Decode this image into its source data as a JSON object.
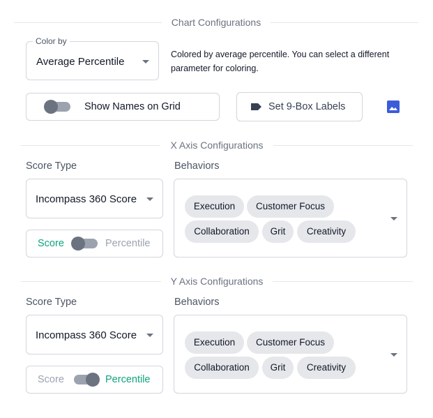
{
  "chart_config": {
    "section_title": "Chart Configurations",
    "color_by": {
      "legend": "Color by",
      "value": "Average Percentile",
      "help_text": "Colored by average percentile. You can select a different parameter for coloring."
    },
    "show_names_button": {
      "label": "Show Names on Grid",
      "enabled": false
    },
    "labels_button": {
      "label": "Set 9-Box Labels",
      "icon": "tag-icon"
    },
    "image_button": {
      "icon": "image-icon"
    }
  },
  "x_axis": {
    "section_title": "X Axis Configurations",
    "score_type_label": "Score Type",
    "score_type_value": "Incompass 360 Score",
    "toggle": {
      "left": "Score",
      "right": "Percentile",
      "selected": "Score"
    },
    "behaviors_label": "Behaviors",
    "behaviors": [
      "Execution",
      "Customer Focus",
      "Collaboration",
      "Grit",
      "Creativity"
    ]
  },
  "y_axis": {
    "section_title": "Y Axis Configurations",
    "score_type_label": "Score Type",
    "score_type_value": "Incompass 360 Score",
    "toggle": {
      "left": "Score",
      "right": "Percentile",
      "selected": "Percentile"
    },
    "behaviors_label": "Behaviors",
    "behaviors": [
      "Execution",
      "Customer Focus",
      "Collaboration",
      "Grit",
      "Creativity"
    ]
  },
  "colors": {
    "active_toggle_text": "#10a37f",
    "inactive_toggle_text": "#9ca3af",
    "image_icon": "#3b5bdb"
  }
}
